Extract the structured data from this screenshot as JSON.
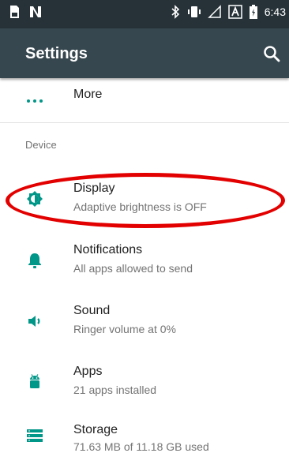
{
  "status_bar": {
    "time": "6:43",
    "left_icons": [
      "sim-card-icon",
      "nfc-icon"
    ],
    "right_icons": [
      "bluetooth-icon",
      "vibrate-icon",
      "signal-icon",
      "auto-rotate-box-icon",
      "battery-icon"
    ]
  },
  "app_bar": {
    "title": "Settings",
    "search_icon": "search-icon"
  },
  "menu": {
    "more_label": "More"
  },
  "section": {
    "device_label": "Device"
  },
  "items": [
    {
      "title": "Display",
      "subtitle": "Adaptive brightness is OFF",
      "icon": "brightness-icon"
    },
    {
      "title": "Notifications",
      "subtitle": "All apps allowed to send",
      "icon": "bell-icon"
    },
    {
      "title": "Sound",
      "subtitle": "Ringer volume at 0%",
      "icon": "volume-icon"
    },
    {
      "title": "Apps",
      "subtitle": "21 apps installed",
      "icon": "android-icon"
    },
    {
      "title": "Storage",
      "subtitle": "71.63 MB of 11.18 GB used",
      "icon": "storage-icon"
    }
  ],
  "colors": {
    "status_bar": "#263238",
    "app_bar": "#37474f",
    "accent": "#009688",
    "annotation": "#e30000"
  }
}
